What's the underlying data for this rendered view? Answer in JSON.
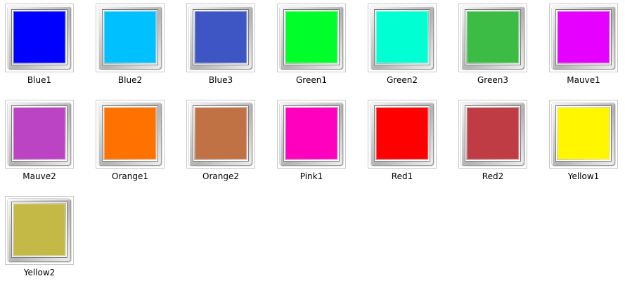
{
  "items": [
    {
      "label": "Blue1",
      "color": "#0000ff"
    },
    {
      "label": "Blue2",
      "color": "#00c0ff"
    },
    {
      "label": "Blue3",
      "color": "#3e55c4"
    },
    {
      "label": "Green1",
      "color": "#00ff2a"
    },
    {
      "label": "Green2",
      "color": "#00ffd2"
    },
    {
      "label": "Green3",
      "color": "#3dbc45"
    },
    {
      "label": "Mauve1",
      "color": "#e600ff"
    },
    {
      "label": "Mauve2",
      "color": "#bb44c4"
    },
    {
      "label": "Orange1",
      "color": "#ff7200"
    },
    {
      "label": "Orange2",
      "color": "#c07245"
    },
    {
      "label": "Pink1",
      "color": "#ff00bf"
    },
    {
      "label": "Red1",
      "color": "#ff0000"
    },
    {
      "label": "Red2",
      "color": "#c03c45"
    },
    {
      "label": "Yellow1",
      "color": "#fff600"
    },
    {
      "label": "Yellow2",
      "color": "#c4b947"
    }
  ]
}
